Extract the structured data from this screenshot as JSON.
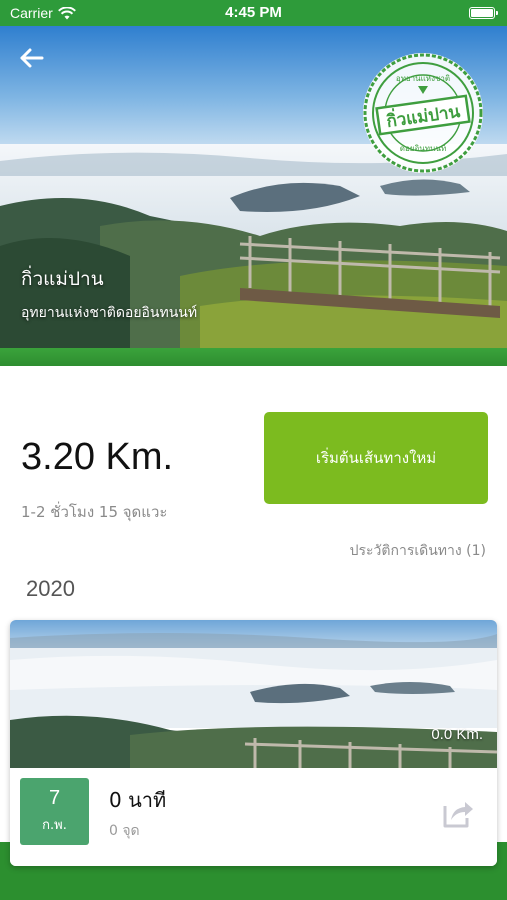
{
  "status_bar": {
    "carrier": "Carrier",
    "time": "4:45 PM",
    "wifi_icon": "wifi-icon",
    "battery_icon": "battery-icon"
  },
  "hero": {
    "back_icon": "arrow-left-icon",
    "title": "กิ่วแม่ปาน",
    "subtitle": "อุทยานแห่งชาติดอยอินทนนท์",
    "stamp": {
      "main_text": "กิ่วแม่ปาน",
      "top_text": "อุทยานแห่งชาติ",
      "bottom_text": "ดอยอินทนนท์"
    }
  },
  "route": {
    "distance": "3.20 Km.",
    "duration": "1-2 ชั่วโมง 15 จุดแวะ",
    "start_button": "เริ่มต้นเส้นทางใหม่",
    "history_link": "ประวัติการเดินทาง (1)"
  },
  "history": {
    "year": "2020",
    "trips": [
      {
        "distance": "0.0 Km.",
        "day": "7",
        "month": "ก.พ.",
        "duration": "0 นาที",
        "stops": "0 จุด",
        "share_icon": "share-icon"
      }
    ]
  },
  "colors": {
    "brand_green": "#2e9b3a",
    "button_green": "#7cbb1f",
    "date_green": "#4ba46e"
  }
}
